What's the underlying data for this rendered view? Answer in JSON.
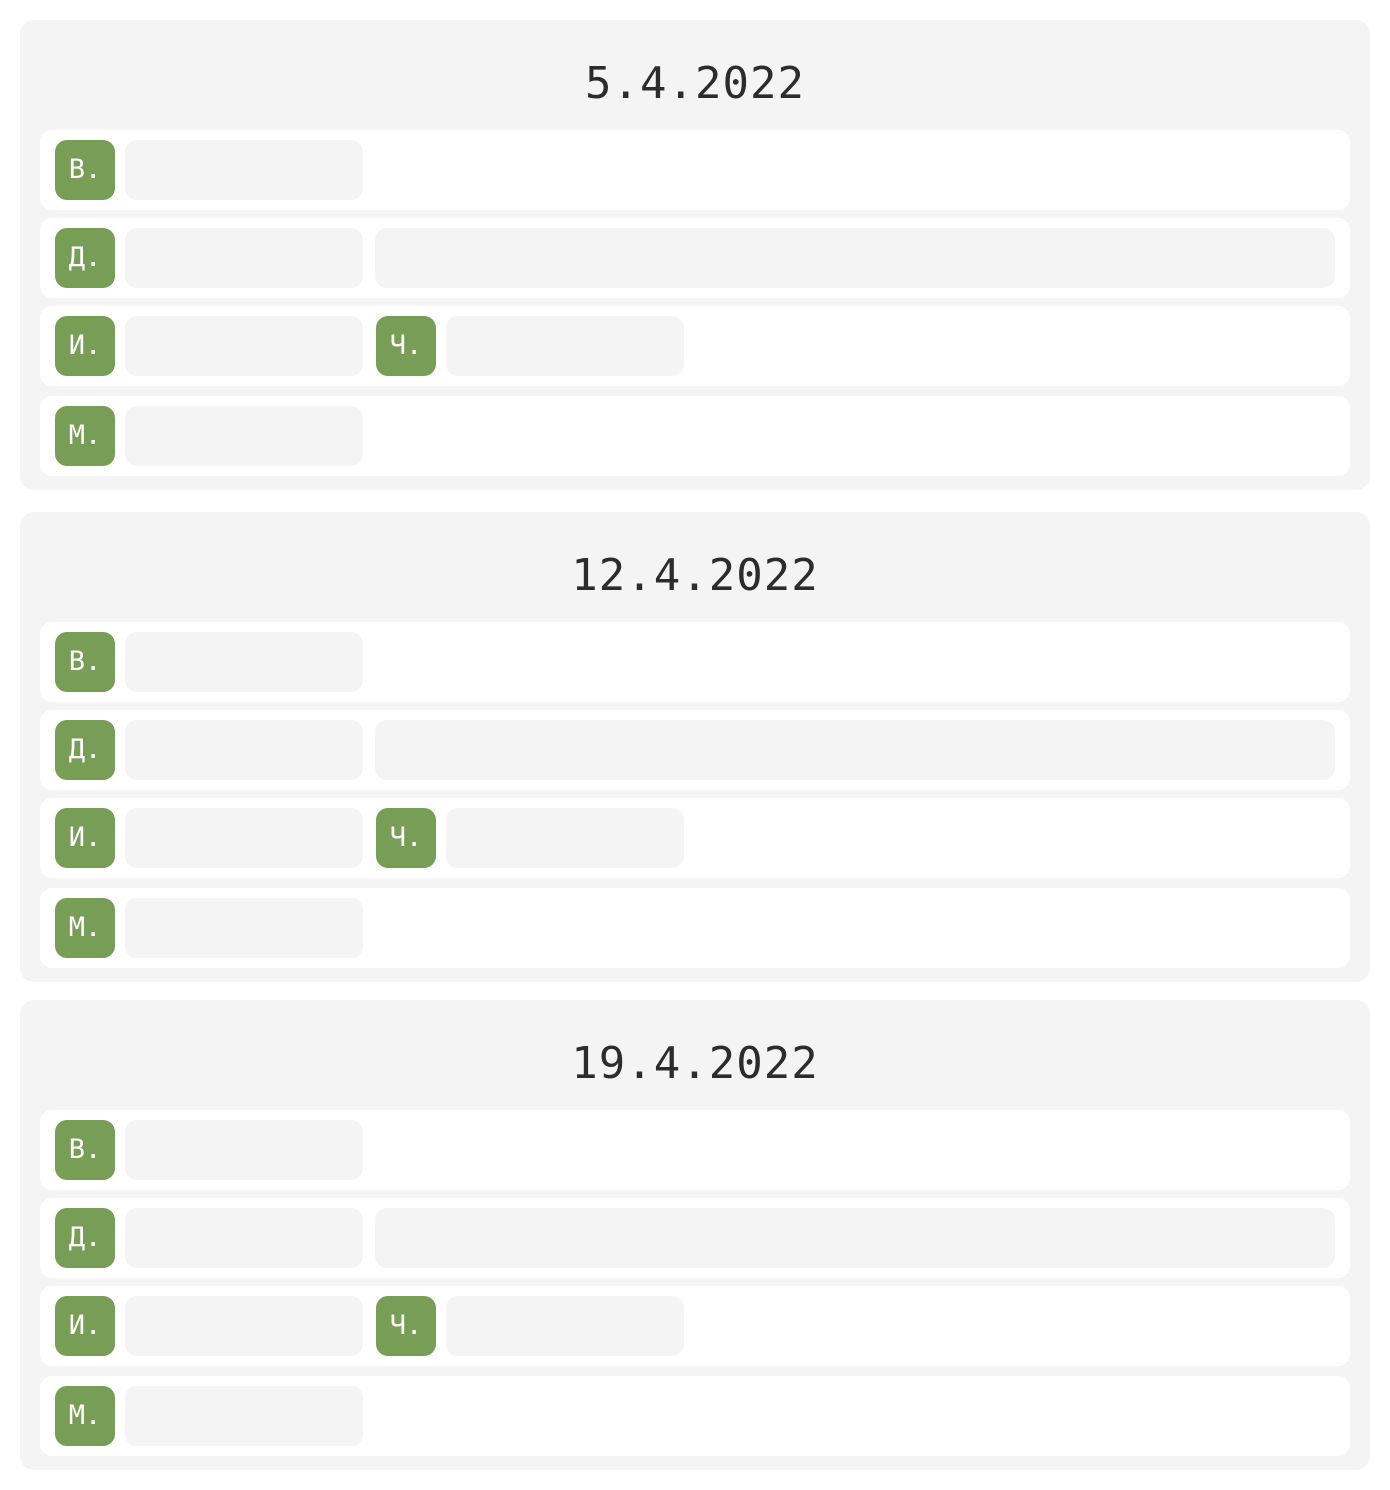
{
  "colors": {
    "card_background": "#f4f4f4",
    "row_background": "#ffffff",
    "badge": "#789d56",
    "field": "#f4f4f4",
    "title_text": "#2c2c2c"
  },
  "cards": [
    {
      "date": "5.4.2022",
      "rows": [
        {
          "badge": "В.",
          "field": ""
        },
        {
          "badge": "Д.",
          "field": "",
          "wide_field": ""
        },
        {
          "badge": "И.",
          "field": "",
          "badge2": "Ч.",
          "field2": ""
        },
        {
          "badge": "М.",
          "field": ""
        }
      ]
    },
    {
      "date": "12.4.2022",
      "rows": [
        {
          "badge": "В.",
          "field": ""
        },
        {
          "badge": "Д.",
          "field": "",
          "wide_field": ""
        },
        {
          "badge": "И.",
          "field": "",
          "badge2": "Ч.",
          "field2": ""
        },
        {
          "badge": "М.",
          "field": ""
        }
      ]
    },
    {
      "date": "19.4.2022",
      "rows": [
        {
          "badge": "В.",
          "field": ""
        },
        {
          "badge": "Д.",
          "field": "",
          "wide_field": ""
        },
        {
          "badge": "И.",
          "field": "",
          "badge2": "Ч.",
          "field2": ""
        },
        {
          "badge": "М.",
          "field": ""
        }
      ]
    }
  ]
}
